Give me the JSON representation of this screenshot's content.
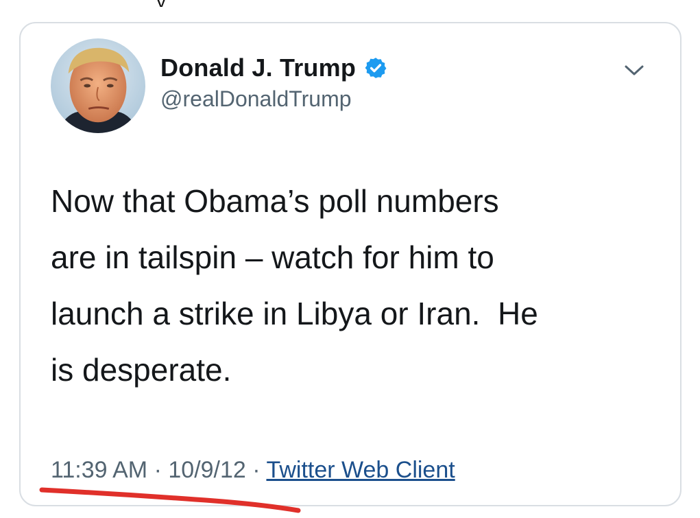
{
  "tweet": {
    "display_name": "Donald J. Trump",
    "handle": "@realDonaldTrump",
    "text": "Now that Obama’s poll numbers\nare in tailspin – watch for him to\nlaunch a strike in Libya or Iran.  He\nis desperate.",
    "time": "11:39 AM",
    "date": "10/9/12",
    "source": "Twitter Web Client",
    "separator": "·",
    "verified": true
  },
  "icons": {
    "verified": "verified-badge-icon",
    "menu": "chevron-down-icon",
    "avatar": "profile-photo"
  },
  "colors": {
    "name": "#14171a",
    "handle": "#536471",
    "verified_badge": "#1d9bf0",
    "source_link": "#1b4f8c",
    "annotation": "#e0302a",
    "card_border": "#d9dee3"
  }
}
